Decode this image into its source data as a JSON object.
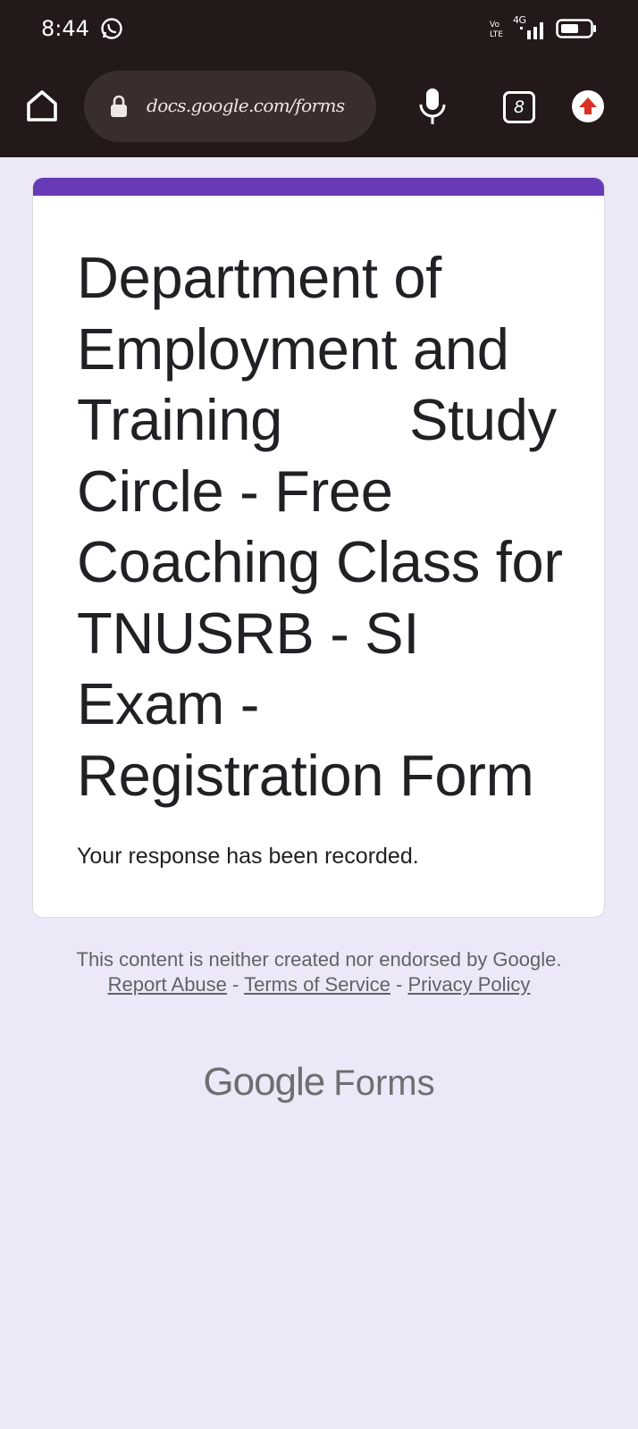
{
  "status_bar": {
    "time": "8:44",
    "network": "4G",
    "icons": [
      "whatsapp-icon",
      "volte-icon",
      "signal-icon",
      "battery-icon"
    ]
  },
  "browser": {
    "url": "docs.google.com/forms",
    "tab_count": "8",
    "icons": [
      "home-icon",
      "lock-icon",
      "mic-icon",
      "upload-icon"
    ]
  },
  "form": {
    "title": "Department of Employment and Training        Study Circle - Free Coaching Class for TNUSRB - SI Exam - Registration Form",
    "response_message": "Your response has been recorded.",
    "accent_color": "#673ab7"
  },
  "footer": {
    "disclaimer": "This content is neither created nor endorsed by Google.",
    "separator": "-",
    "report_abuse": "Report Abuse",
    "terms": "Terms of Service",
    "privacy": "Privacy Policy",
    "logo_google": "Google",
    "logo_forms": "Forms"
  },
  "colors": {
    "background": "#ede8f7",
    "topbar": "#221918",
    "text": "#202124"
  }
}
